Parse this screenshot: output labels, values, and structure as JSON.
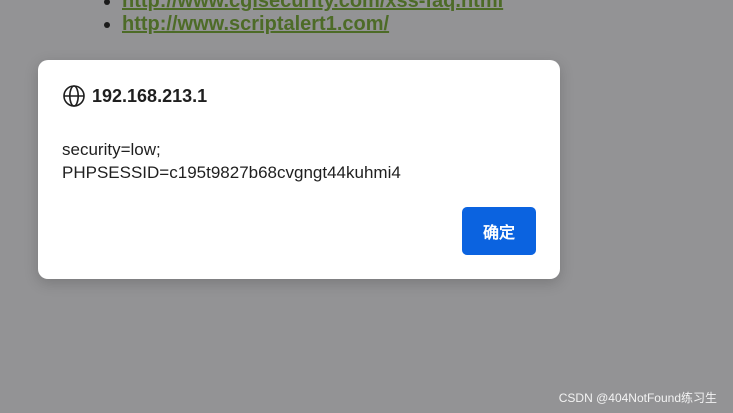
{
  "page": {
    "links": [
      "http://www.cgisecurity.com/xss-faq.html",
      "http://www.scriptalert1.com/"
    ]
  },
  "dialog": {
    "origin": "192.168.213.1",
    "origin_icon": "globe-icon",
    "message_lines": [
      "security=low;",
      "PHPSESSID=c195t9827b68cvgngt44kuhmi4"
    ],
    "ok_label": "确定"
  },
  "watermark": "CSDN @404NotFound练习生",
  "colors": {
    "overlay_background": "#939395",
    "link_color": "#4d6b27",
    "button_accent": "#0b63e0",
    "dialog_background": "#ffffff"
  }
}
